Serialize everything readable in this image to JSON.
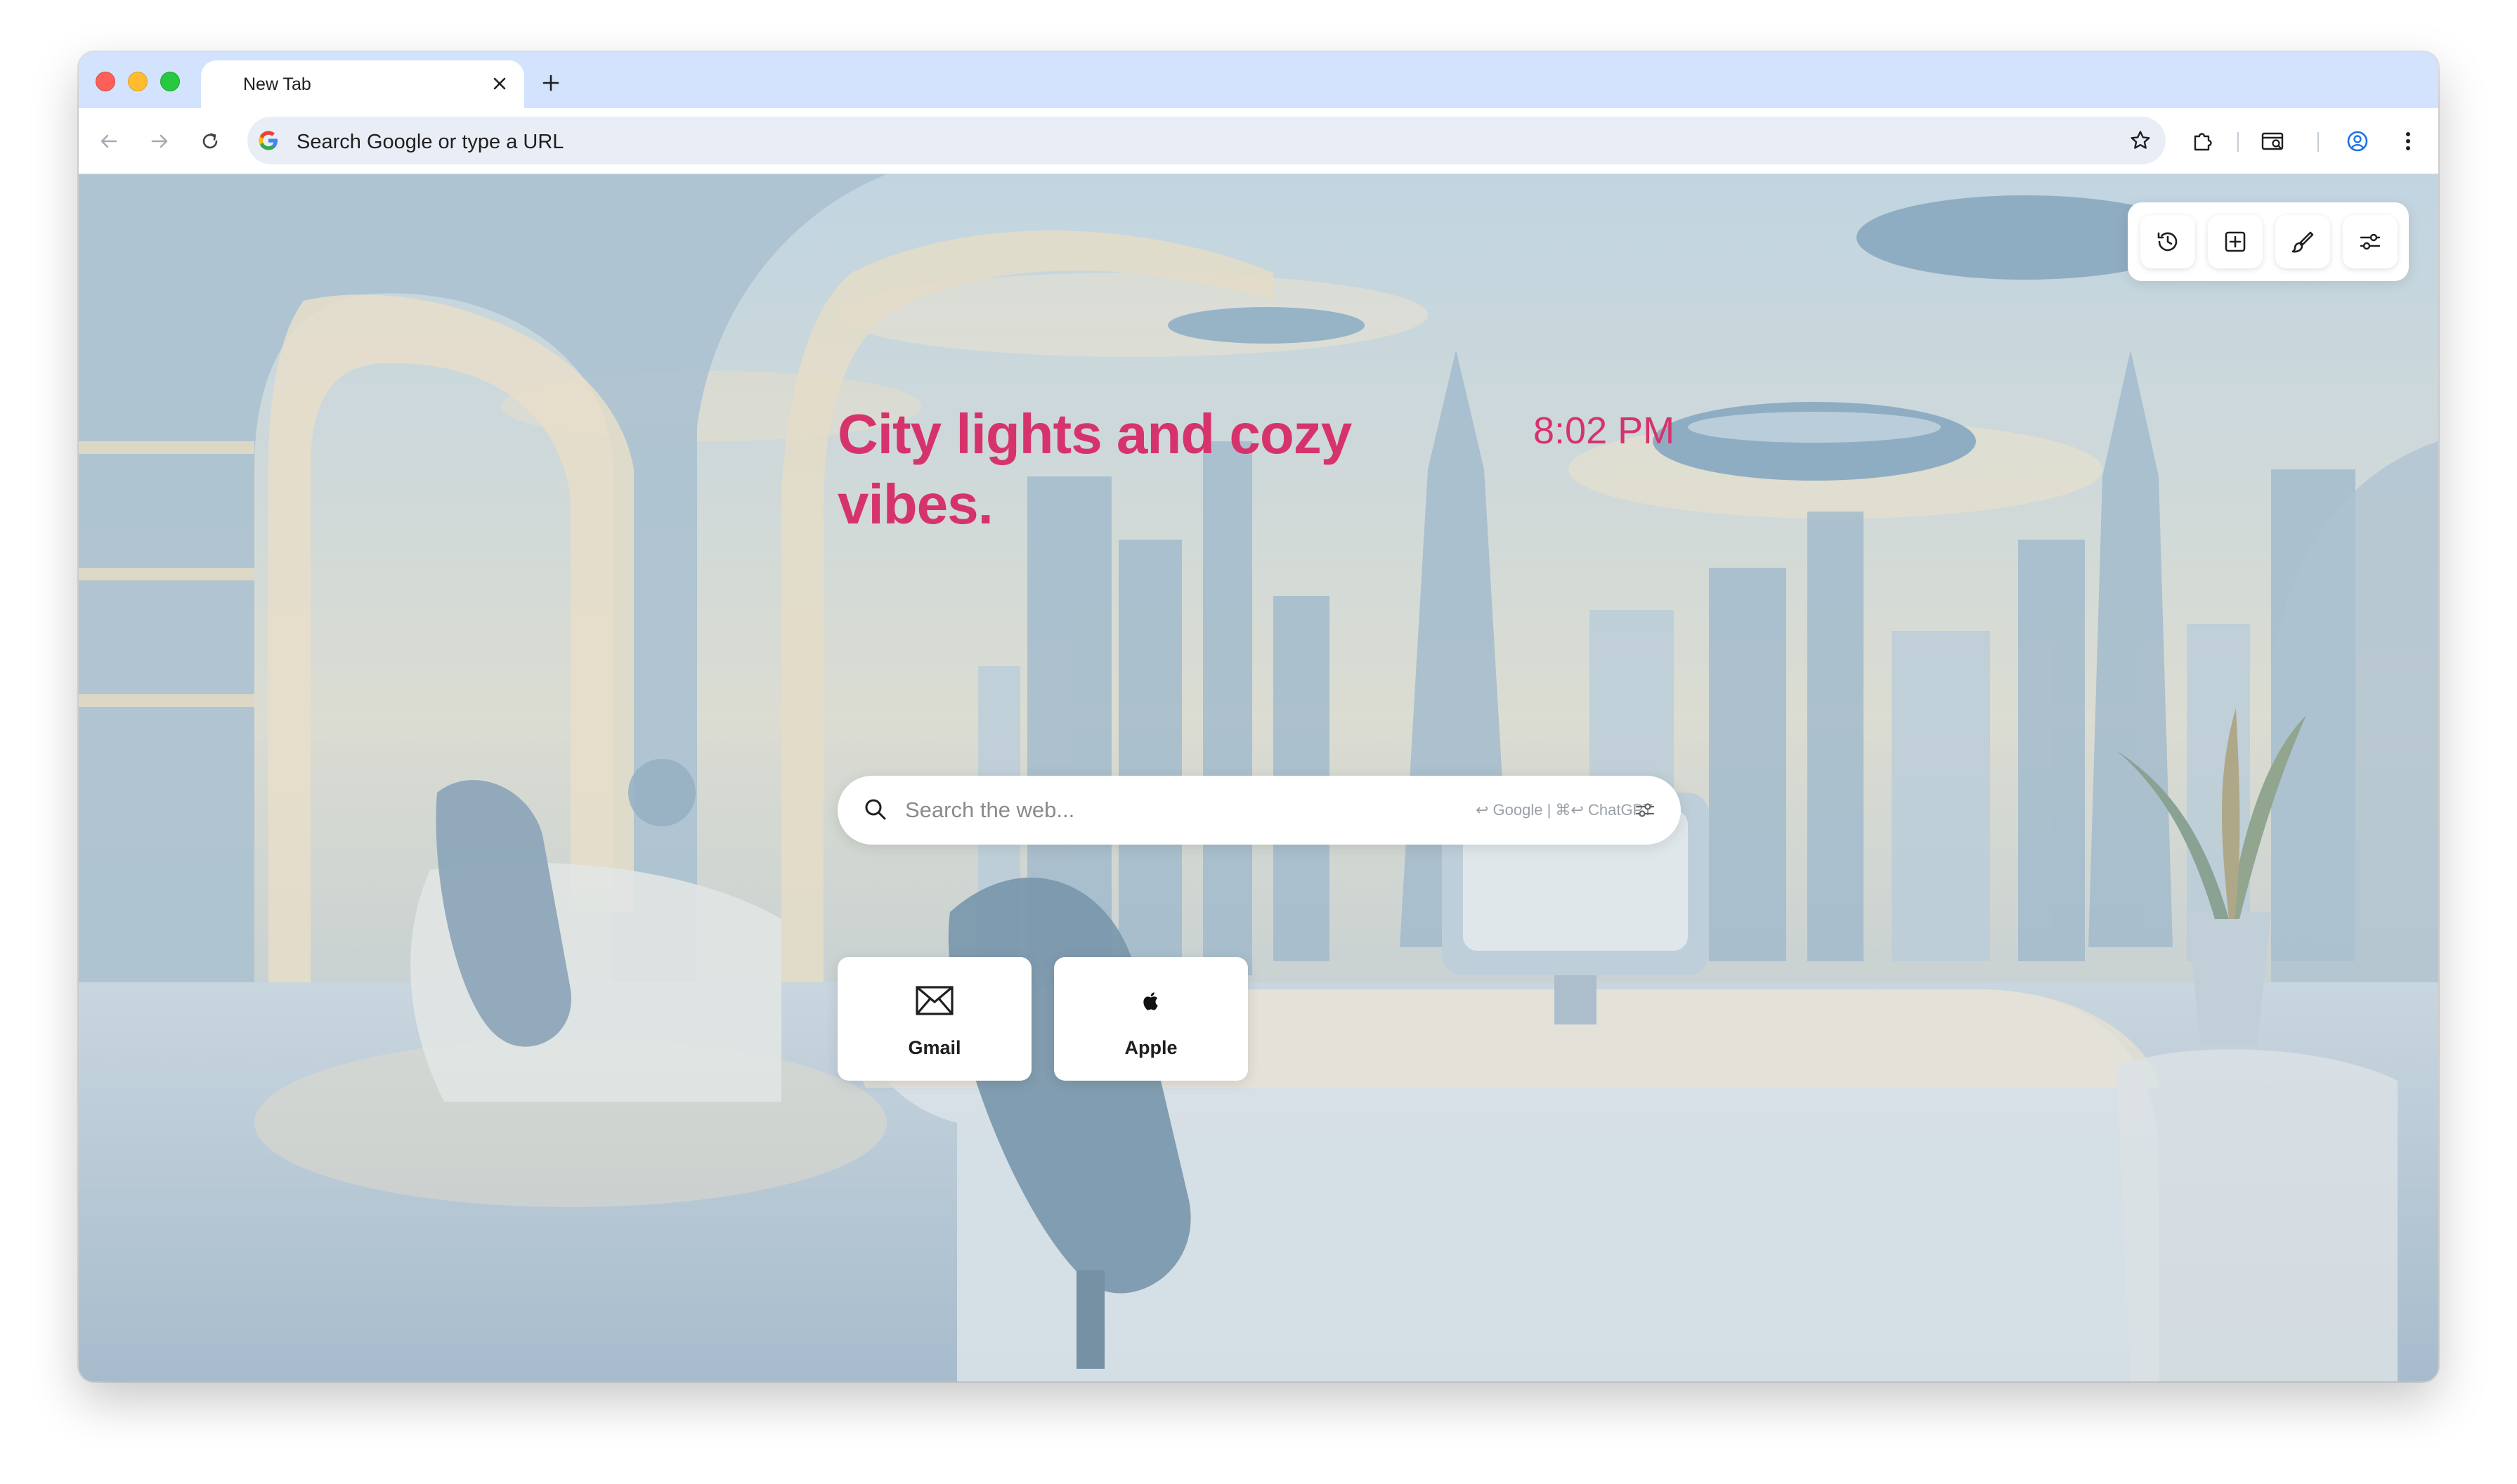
{
  "browser": {
    "tab_title": "New Tab",
    "omnibox_placeholder": "Search Google or type a URL"
  },
  "newtab": {
    "tagline": "City lights and cozy vibes.",
    "clock": "8:02 PM",
    "search": {
      "placeholder": "Search the web...",
      "hint": "↩ Google | ⌘↩ ChatGPT"
    },
    "shortcuts": [
      {
        "label": "Gmail",
        "icon": "mail-icon"
      },
      {
        "label": "Apple",
        "icon": "apple-logo-icon"
      }
    ],
    "quick_actions": [
      "history-icon",
      "add-square-icon",
      "paint-brush-icon",
      "sliders-icon"
    ]
  },
  "colors": {
    "accent": "#d6336c",
    "tabstrip": "#d3e3fd",
    "omnibox": "#e9eef6",
    "background_sky": "#a9c3d6",
    "background_cream": "#e8dcc3"
  }
}
